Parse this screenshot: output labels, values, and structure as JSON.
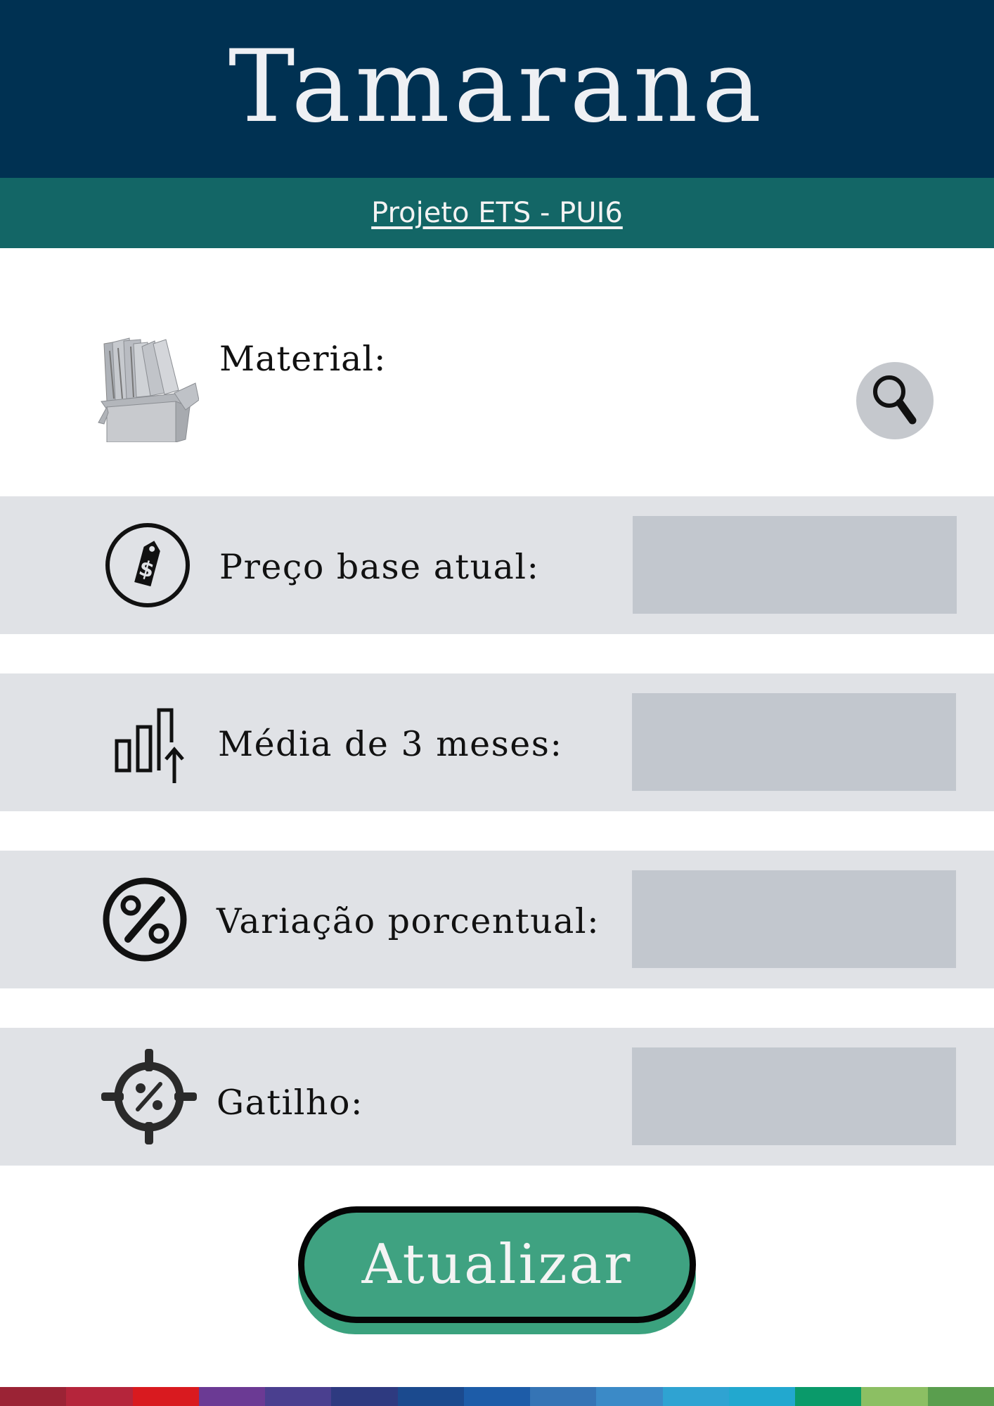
{
  "header": {
    "title": "Tamarana"
  },
  "subheader": {
    "link_text": "Projeto ETS - PUI6"
  },
  "material": {
    "label": "Material:"
  },
  "fields": [
    {
      "label": "Preço base atual:",
      "value": ""
    },
    {
      "label": "Média de 3 meses:",
      "value": ""
    },
    {
      "label": "Variação porcentual:",
      "value": ""
    },
    {
      "label": "Gatilho:",
      "value": ""
    }
  ],
  "action": {
    "button_label": "Atualizar"
  },
  "icons": {
    "material": "box-of-papers-icon",
    "search": "magnifier-icon",
    "price": "price-tag-dollar-icon",
    "average": "bar-chart-up-arrow-icon",
    "variation": "percent-circle-icon",
    "trigger": "target-percent-icon"
  },
  "colors": {
    "header_bg": "#003152",
    "subheader_bg": "#136666",
    "row_bg": "#e0e2e6",
    "input_bg": "#c2c7ce",
    "button_bg": "#3fa281",
    "rainbow": [
      "#9b2335",
      "#b5253b",
      "#d91a1f",
      "#6b3a94",
      "#4a3f8f",
      "#2e3a80",
      "#1b4a8e",
      "#1d5ca8",
      "#3574b5",
      "#3b8ac7",
      "#2fa3d2",
      "#22a8cf",
      "#0a9a6a",
      "#8cbf63",
      "#5a9e4e"
    ]
  }
}
